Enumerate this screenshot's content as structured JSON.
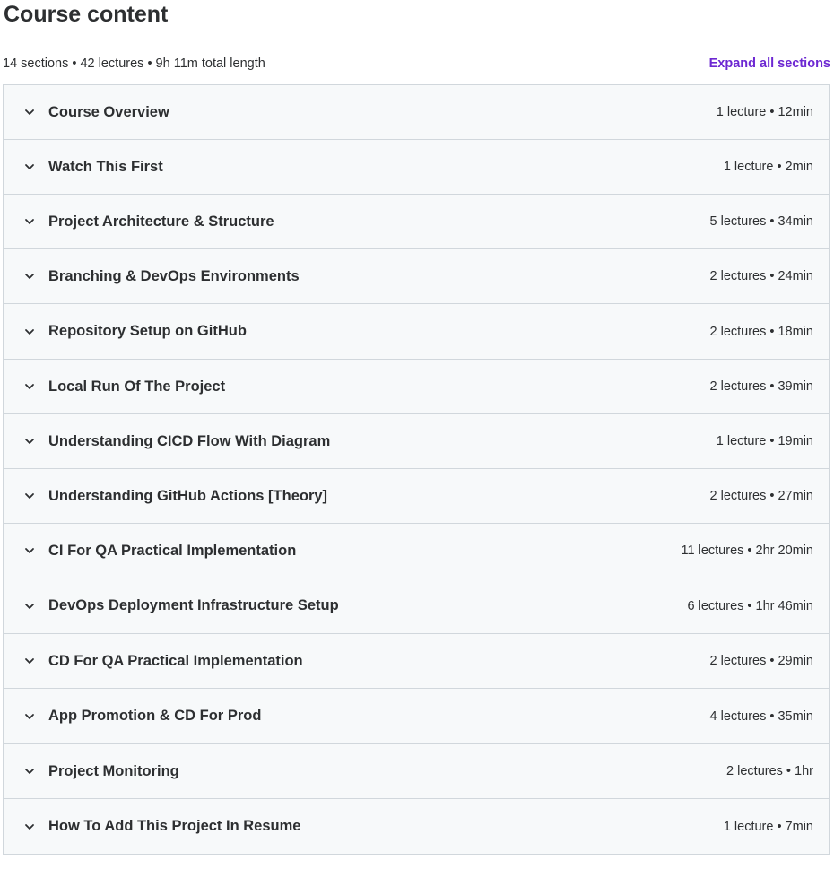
{
  "header": {
    "title": "Course content",
    "summary": "14 sections • 42 lectures • 9h 11m total length",
    "expand_label": "Expand all sections"
  },
  "colors": {
    "accent": "#6d28d2",
    "row_background": "#f7f9fa",
    "border": "#d1d7dc",
    "text": "#2d2f31"
  },
  "icons": {
    "section_toggle": "chevron-down-icon"
  },
  "sections": [
    {
      "title": "Course Overview",
      "meta": "1 lecture • 12min"
    },
    {
      "title": "Watch This First",
      "meta": "1 lecture • 2min"
    },
    {
      "title": "Project Architecture & Structure",
      "meta": "5 lectures • 34min"
    },
    {
      "title": "Branching & DevOps Environments",
      "meta": "2 lectures • 24min"
    },
    {
      "title": "Repository Setup on GitHub",
      "meta": "2 lectures • 18min"
    },
    {
      "title": "Local Run Of The Project",
      "meta": "2 lectures • 39min"
    },
    {
      "title": "Understanding CICD Flow With Diagram",
      "meta": "1 lecture • 19min"
    },
    {
      "title": "Understanding GitHub Actions [Theory]",
      "meta": "2 lectures • 27min"
    },
    {
      "title": "CI For QA Practical Implementation",
      "meta": "11 lectures • 2hr 20min"
    },
    {
      "title": "DevOps Deployment Infrastructure Setup",
      "meta": "6 lectures • 1hr 46min"
    },
    {
      "title": "CD For QA Practical Implementation",
      "meta": "2 lectures • 29min"
    },
    {
      "title": "App Promotion & CD For Prod",
      "meta": "4 lectures • 35min"
    },
    {
      "title": "Project Monitoring",
      "meta": "2 lectures • 1hr"
    },
    {
      "title": "How To Add This Project In Resume",
      "meta": "1 lecture • 7min"
    }
  ]
}
